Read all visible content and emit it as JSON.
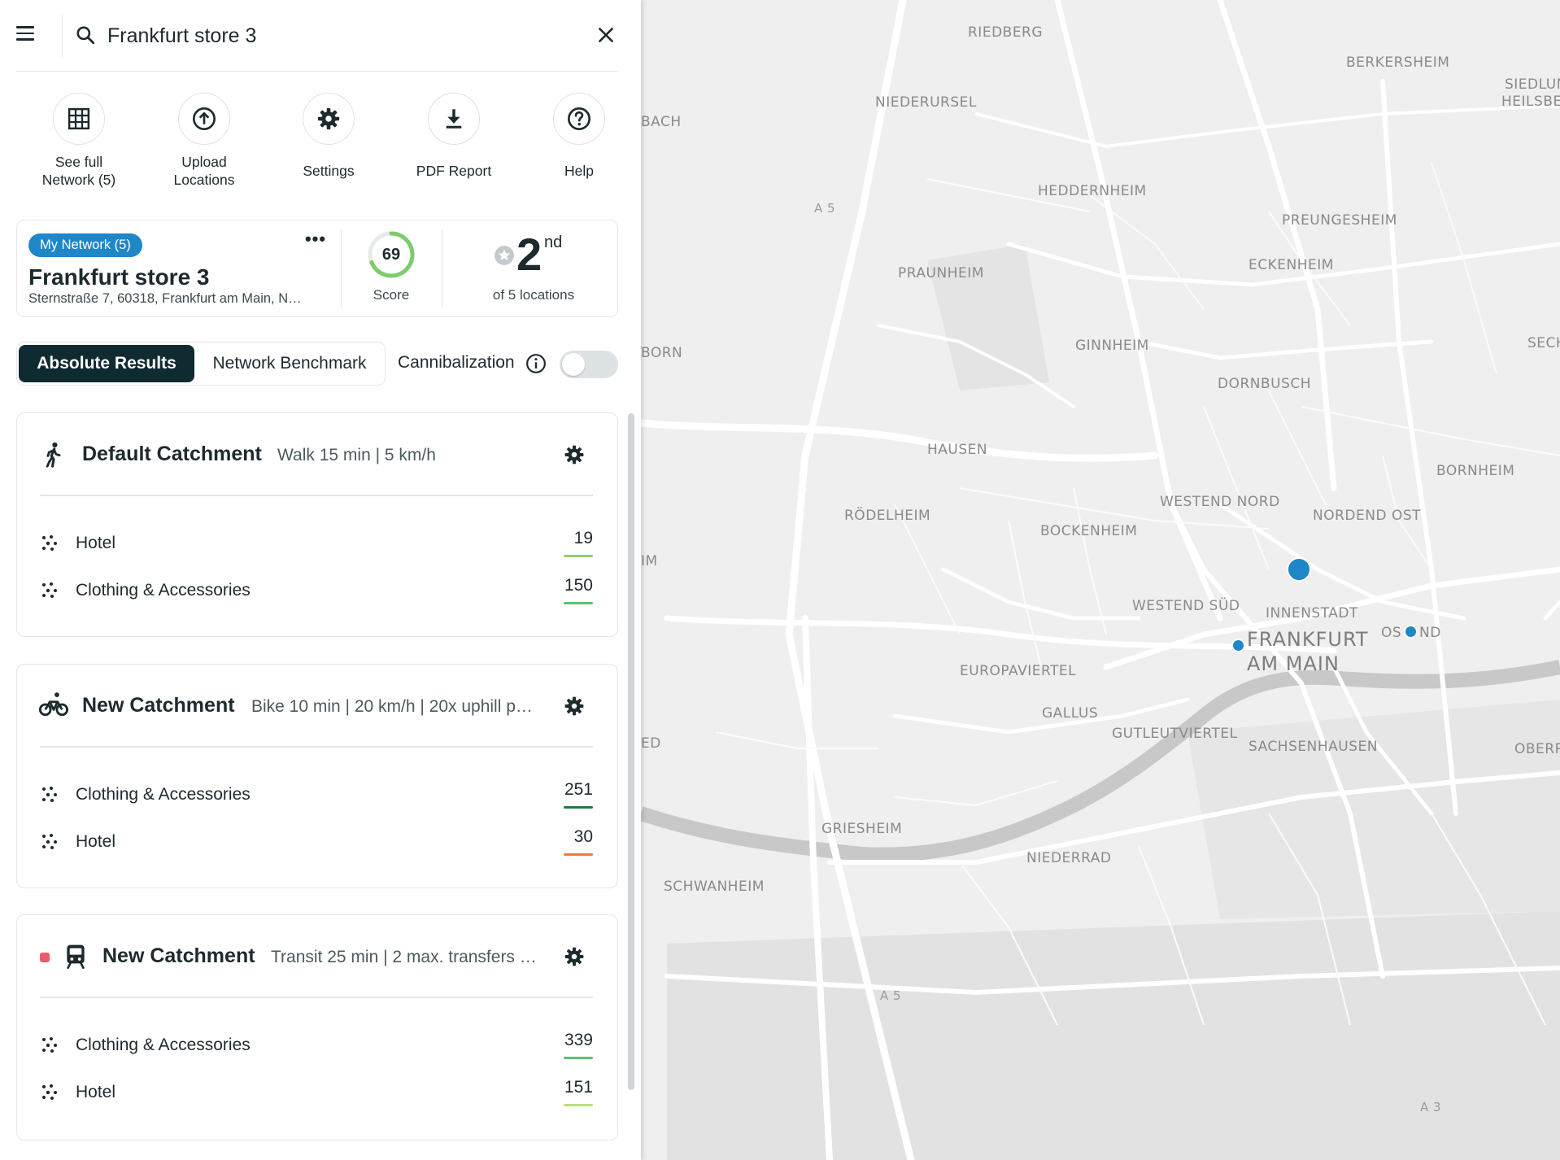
{
  "search": {
    "value": "Frankfurt store 3"
  },
  "actions": [
    {
      "label": "See full\nNetwork (5)",
      "icon": "grid-icon"
    },
    {
      "label": "Upload\nLocations",
      "icon": "upload-icon"
    },
    {
      "label": "Settings",
      "icon": "gear-icon"
    },
    {
      "label": "PDF Report",
      "icon": "download-icon"
    },
    {
      "label": "Help",
      "icon": "help-icon"
    }
  ],
  "location": {
    "badge": "My Network (5)",
    "name": "Frankfurt store 3",
    "address": "Sternstraße 7, 60318, Frankfurt am Main, N…",
    "score": "69",
    "score_fraction": 0.69,
    "score_label": "Score",
    "rank": "2",
    "rank_suffix": "nd",
    "rank_label": "of 5 locations"
  },
  "tabs": {
    "active": "Absolute Results",
    "inactive": "Network Benchmark",
    "cannibalization": "Cannibalization",
    "cannibalization_enabled": false
  },
  "catchments": [
    {
      "mode": "walk-icon",
      "title": "Default Catchment",
      "subtitle": "Walk 15 min | 5 km/h",
      "rows": [
        {
          "label": "Hotel",
          "value": "19",
          "bar_color": "#8fd16a"
        },
        {
          "label": "Clothing & Accessories",
          "value": "150",
          "bar_color": "#5cc36b"
        }
      ]
    },
    {
      "mode": "bike-icon",
      "title": "New Catchment",
      "subtitle": "Bike 10 min | 20 km/h | 20x uphill p…",
      "rows": [
        {
          "label": "Clothing & Accessories",
          "value": "251",
          "bar_color": "#1f7a45"
        },
        {
          "label": "Hotel",
          "value": "30",
          "bar_color": "#f0793d"
        }
      ]
    },
    {
      "mode": "train-icon",
      "title": "New Catchment",
      "subtitle": "Transit 25 min | 2 max. transfers …",
      "rows": [
        {
          "label": "Clothing & Accessories",
          "value": "339",
          "bar_color": "#5cc36b"
        },
        {
          "label": "Hotel",
          "value": "151",
          "bar_color": "#b7e07a"
        }
      ]
    }
  ],
  "colors": {
    "accent_blue": "#1f86c8",
    "dark_teal": "#102a31",
    "marker_blue": "#1f86c8"
  },
  "map": {
    "labels": [
      "RIEDBERG",
      "BERKERSHEIM",
      "SIEDLUN",
      "HEILSBE",
      "NIEDERURSEL",
      "BACH",
      "A 5",
      "HEDDERNHEIM",
      "PREUNGESHEIM",
      "ECKENHEIM",
      "PRAUNHEIM",
      "BORN",
      "GINNHEIM",
      "SECH",
      "DORNBUSCH",
      "HAUSEN",
      "BORNHEIM",
      "WESTEND NORD",
      "RÖDELHEIM",
      "NORDEND OST",
      "BOCKENHEIM",
      "IM",
      "WESTEND SÜD",
      "INNENSTADT",
      "OS",
      "ND",
      "FRANKFURT",
      "AM MAIN",
      "EUROPAVIERTEL",
      "GALLUS",
      "GUTLEUTVIERTEL",
      "SACHSENHAUSEN",
      "OBERR",
      "ED",
      "GRIESHEIM",
      "NIEDERRAD",
      "SCHWANHEIM",
      "A 5",
      "A 3"
    ]
  }
}
